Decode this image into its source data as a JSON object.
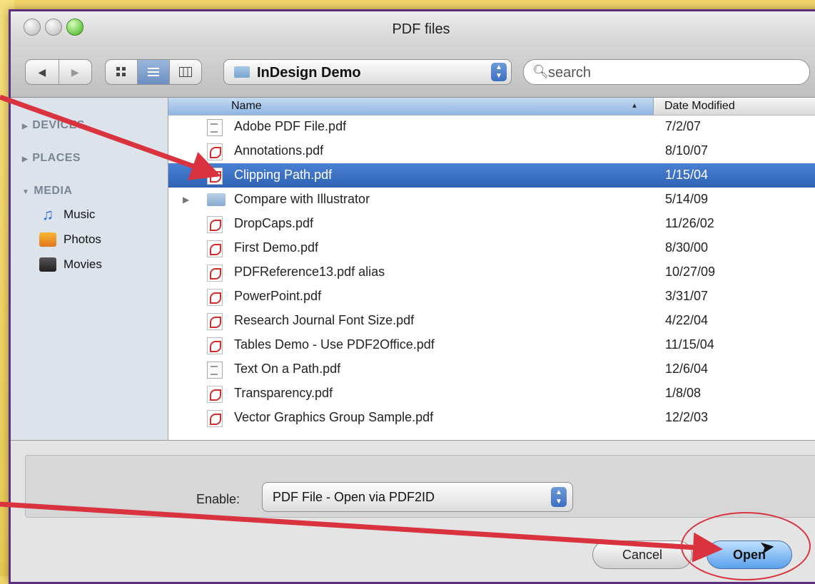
{
  "window": {
    "title": "PDF files"
  },
  "toolbar": {
    "nav": {
      "back": "◀",
      "forward": "▶"
    },
    "view_modes": [
      "icon-view",
      "list-view",
      "column-view"
    ],
    "location": "InDesign Demo",
    "search_placeholder": "search"
  },
  "sidebar": {
    "sections": [
      {
        "label": "DEVICES",
        "expanded": false,
        "items": []
      },
      {
        "label": "PLACES",
        "expanded": false,
        "items": []
      },
      {
        "label": "MEDIA",
        "expanded": true,
        "items": [
          {
            "label": "Music",
            "icon": "music-icon"
          },
          {
            "label": "Photos",
            "icon": "photos-icon"
          },
          {
            "label": "Movies",
            "icon": "movies-icon"
          }
        ]
      }
    ]
  },
  "columns": {
    "name": "Name",
    "date": "Date Modified"
  },
  "files": [
    {
      "name": "Adobe PDF File.pdf",
      "date": "7/2/07",
      "kind": "txt",
      "selected": false
    },
    {
      "name": "Annotations.pdf",
      "date": "8/10/07",
      "kind": "pdf",
      "selected": false
    },
    {
      "name": "Clipping Path.pdf",
      "date": "1/15/04",
      "kind": "pdf",
      "selected": true
    },
    {
      "name": "Compare with Illustrator",
      "date": "5/14/09",
      "kind": "folder",
      "selected": false
    },
    {
      "name": "DropCaps.pdf",
      "date": "11/26/02",
      "kind": "pdf",
      "selected": false
    },
    {
      "name": "First Demo.pdf",
      "date": "8/30/00",
      "kind": "pdf",
      "selected": false
    },
    {
      "name": "PDFReference13.pdf alias",
      "date": "10/27/09",
      "kind": "pdf",
      "selected": false
    },
    {
      "name": "PowerPoint.pdf",
      "date": "3/31/07",
      "kind": "pdf",
      "selected": false
    },
    {
      "name": "Research Journal Font Size.pdf",
      "date": "4/22/04",
      "kind": "pdf",
      "selected": false
    },
    {
      "name": "Tables Demo - Use PDF2Office.pdf",
      "date": "11/15/04",
      "kind": "pdf",
      "selected": false
    },
    {
      "name": "Text On a Path.pdf",
      "date": "12/6/04",
      "kind": "txt",
      "selected": false
    },
    {
      "name": "Transparency.pdf",
      "date": "1/8/08",
      "kind": "pdf",
      "selected": false
    },
    {
      "name": "Vector Graphics Group Sample.pdf",
      "date": "12/2/03",
      "kind": "pdf",
      "selected": false
    }
  ],
  "enable": {
    "label": "Enable:",
    "value": "PDF File - Open via PDF2ID"
  },
  "buttons": {
    "cancel": "Cancel",
    "open": "Open"
  },
  "annotation_color": "#d9333f"
}
